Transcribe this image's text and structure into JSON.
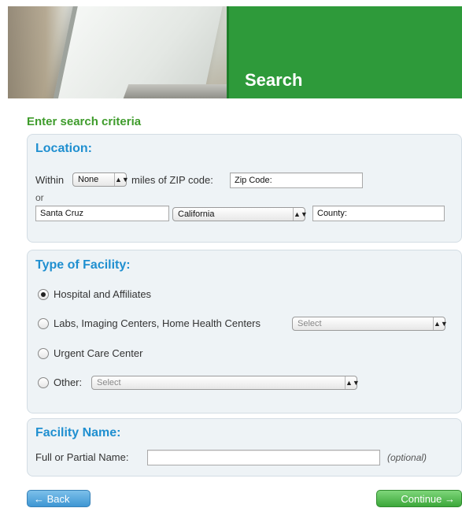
{
  "banner": {
    "title": "Search"
  },
  "heading": "Enter search criteria",
  "location": {
    "title": "Location:",
    "within_label": "Within",
    "radius_value": "None",
    "miles_label": "miles of ZIP code:",
    "zip_value": "Zip Code:",
    "or_label": "or",
    "city_value": "Santa Cruz",
    "state_value": "California",
    "county_value": "County:"
  },
  "facility_type": {
    "title": "Type of Facility:",
    "options": [
      {
        "label": "Hospital and Affiliates",
        "checked": true
      },
      {
        "label": "Labs, Imaging Centers, Home Health Centers",
        "select": "Select"
      },
      {
        "label": "Urgent Care Center"
      },
      {
        "label": "Other:",
        "select": "Select"
      }
    ]
  },
  "facility_name": {
    "title": "Facility Name:",
    "label": "Full or Partial Name:",
    "value": "",
    "optional_note": "(optional)"
  },
  "nav": {
    "back_label": "← Back",
    "continue_label": "Continue →"
  },
  "colors": {
    "accent_green": "#2e9a3a",
    "heading_green": "#3f9c2c",
    "title_blue": "#1f8fd0",
    "panel_bg": "#eef3f6"
  }
}
